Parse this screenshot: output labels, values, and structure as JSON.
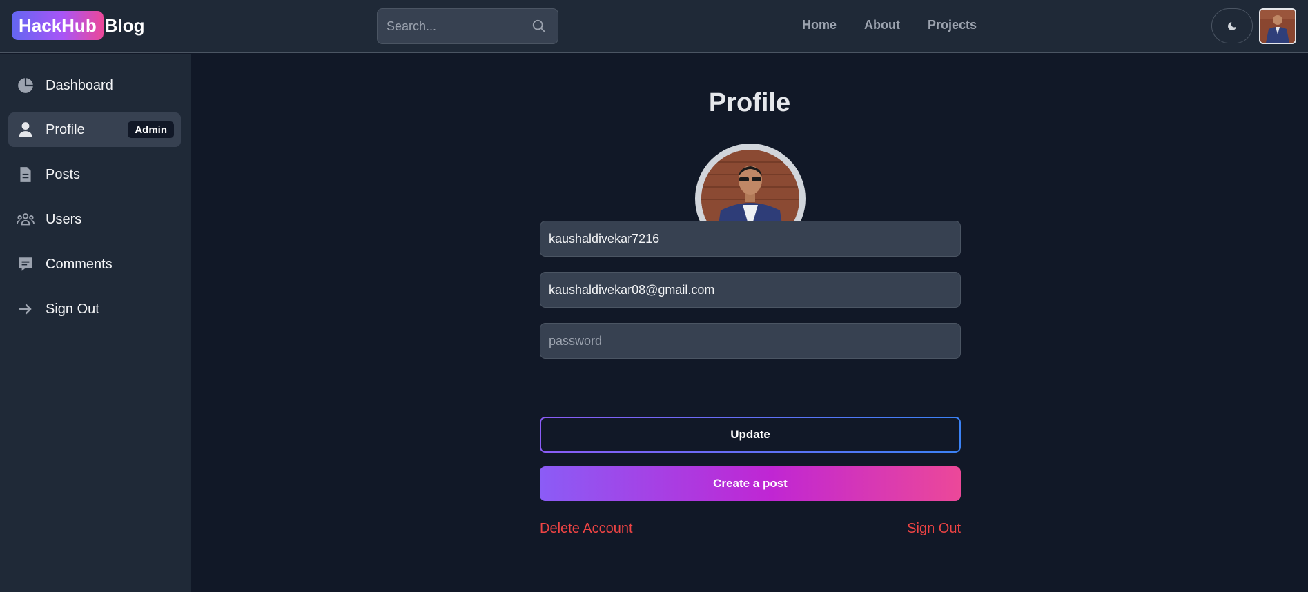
{
  "header": {
    "brand_pill": "HackHub",
    "brand_word": "Blog",
    "search_placeholder": "Search...",
    "nav": [
      "Home",
      "About",
      "Projects"
    ]
  },
  "sidebar": {
    "items": [
      {
        "label": "Dashboard",
        "icon": "pie-chart-icon"
      },
      {
        "label": "Profile",
        "icon": "user-icon",
        "badge": "Admin",
        "active": true
      },
      {
        "label": "Posts",
        "icon": "document-icon"
      },
      {
        "label": "Users",
        "icon": "users-group-icon"
      },
      {
        "label": "Comments",
        "icon": "comment-icon"
      },
      {
        "label": "Sign Out",
        "icon": "arrow-right-icon"
      }
    ]
  },
  "main": {
    "title": "Profile",
    "username_value": "kaushaldivekar7216",
    "email_value": "kaushaldivekar08@gmail.com",
    "password_placeholder": "password",
    "update_label": "Update",
    "create_post_label": "Create a post",
    "delete_account_label": "Delete Account",
    "sign_out_label": "Sign Out"
  },
  "colors": {
    "background": "#111827",
    "panel": "#1f2937",
    "input": "#374151",
    "danger": "#ef4444",
    "gradient_start": "#8b5cf6",
    "gradient_end": "#ec4899"
  }
}
